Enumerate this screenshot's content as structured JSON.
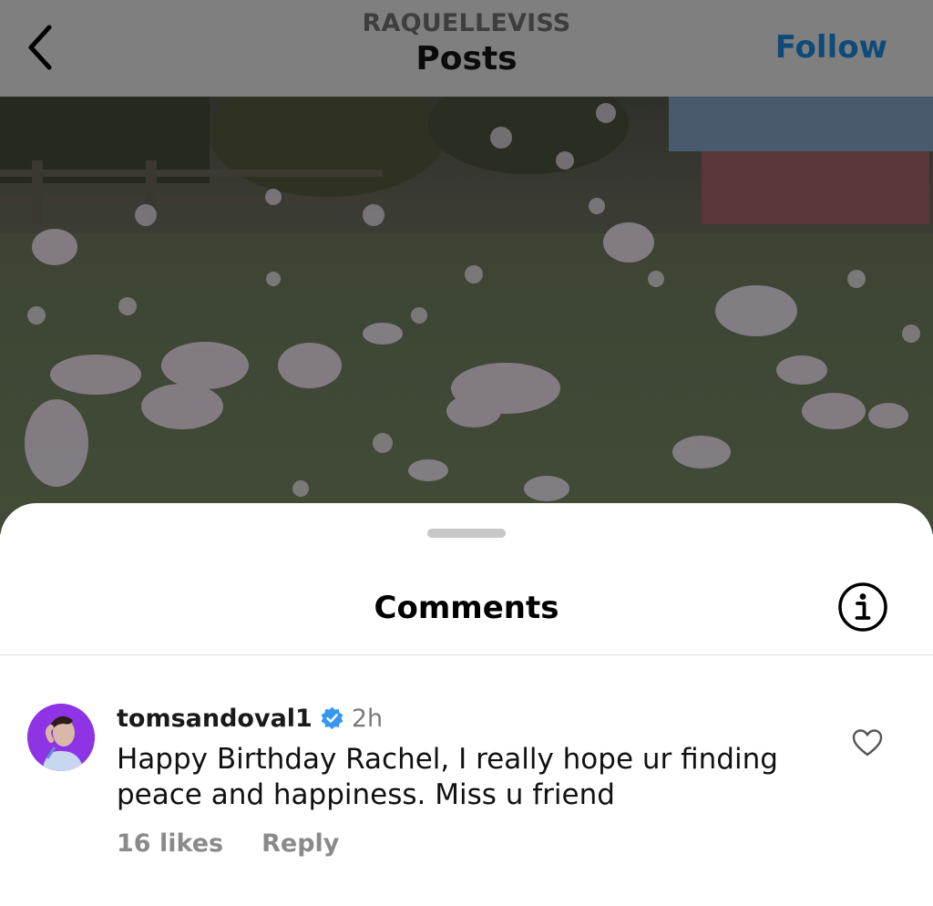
{
  "header": {
    "account": "RAQUELLEVISS",
    "title": "Posts",
    "follow_label": "Follow",
    "back_icon": "chevron-left-icon"
  },
  "media": {
    "description_icon": "post-photo"
  },
  "comments_sheet": {
    "title": "Comments",
    "info_icon": "info-icon",
    "comments": [
      {
        "username": "tomsandoval1",
        "verified": true,
        "time": "2h",
        "text": "Happy Birthday Rachel, I really hope ur finding peace and happiness. Miss u friend",
        "likes": "16 likes",
        "reply_label": "Reply",
        "like_icon": "heart-outline-icon"
      }
    ]
  },
  "colors": {
    "overlay_header": "#7f7f7f",
    "follow_blue": "#0e4a7a",
    "verified_blue": "#3797f0",
    "avatar_purple": "#8a2be2"
  }
}
